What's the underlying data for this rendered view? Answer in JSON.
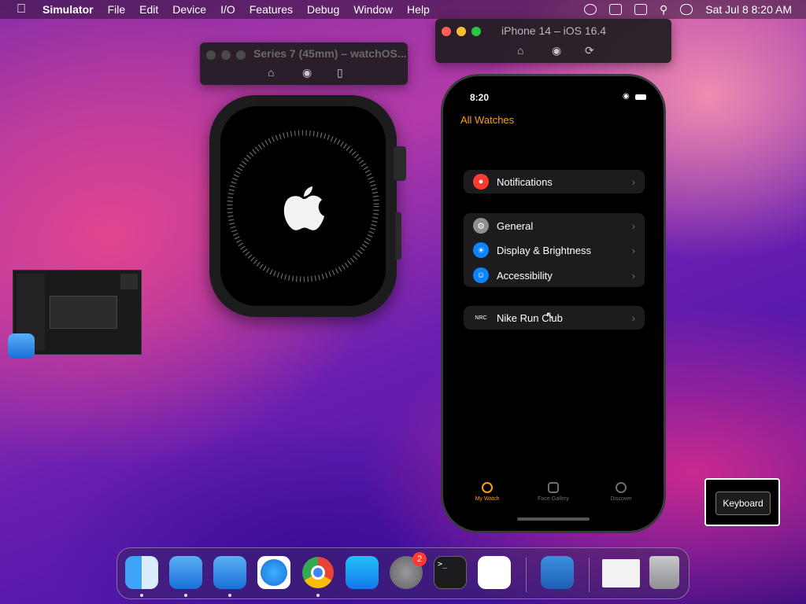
{
  "menubar": {
    "app": "Simulator",
    "items": [
      "File",
      "Edit",
      "Device",
      "I/O",
      "Features",
      "Debug",
      "Window",
      "Help"
    ],
    "datetime": "Sat Jul 8  8:20 AM"
  },
  "watch_window": {
    "title": "Series 7 (45mm) – watchOS..."
  },
  "iphone_window": {
    "title": "iPhone 14 – iOS 16.4"
  },
  "iphone": {
    "status_time": "8:20",
    "back_label": "All Watches",
    "group1": [
      {
        "label": "Notifications",
        "icon": "bell-icon",
        "color": "#ff3b30"
      }
    ],
    "group2": [
      {
        "label": "General",
        "icon": "gear-icon",
        "color": "#8e8e93"
      },
      {
        "label": "Display & Brightness",
        "icon": "sun-icon",
        "color": "#0a84ff"
      },
      {
        "label": "Accessibility",
        "icon": "accessibility-icon",
        "color": "#0a84ff"
      }
    ],
    "group3": [
      {
        "label": "Nike Run Club",
        "icon": "nike-icon",
        "color": "#1c1c1e"
      }
    ],
    "tabs": [
      {
        "label": "My Watch",
        "active": true
      },
      {
        "label": "Face Gallery",
        "active": false
      },
      {
        "label": "Discover",
        "active": false
      }
    ]
  },
  "keyboard": {
    "label": "Keyboard"
  },
  "dock": {
    "apps": [
      "finder-icon",
      "xcode-icon",
      "xcode-beta-icon",
      "safari-icon",
      "chrome-icon",
      "app-store-icon",
      "system-settings-icon",
      "terminal-icon",
      "vscode-icon",
      "weather-icon",
      "chrome-window-icon",
      "trash-icon"
    ],
    "settings_badge": "2"
  }
}
